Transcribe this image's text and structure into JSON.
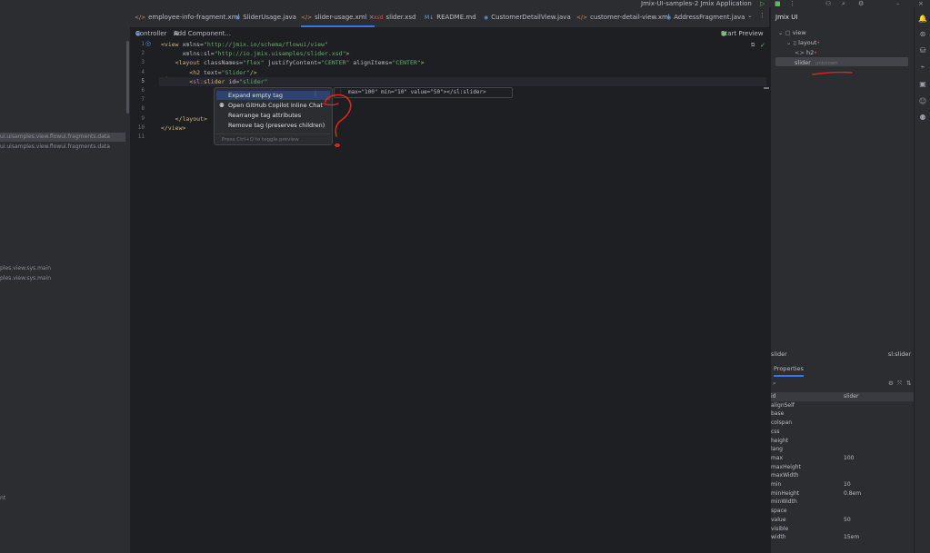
{
  "titlebar": {
    "run_config": "Jmix-UI-samples-2 Jmix Application",
    "icons": [
      "run-icon",
      "debug-icon",
      "more-icon",
      "add-user-icon",
      "search-icon",
      "settings-icon",
      "minimize-icon",
      "close-icon"
    ]
  },
  "project_panel": {
    "rows": [
      {
        "label": "ui.uisamples.view.flowui.fragments.data",
        "selected": true
      },
      {
        "label": "ui.uisamples.view.flowui.fragments.data",
        "selected": false
      },
      {
        "label": "ples.view.sys.main",
        "selected": false
      },
      {
        "label": "ples.view.sys.main",
        "selected": false
      },
      {
        "label": "nt",
        "selected": false
      }
    ]
  },
  "tabs": [
    {
      "label": "employee-info-fragment.xml",
      "type": "xml",
      "active": false
    },
    {
      "label": "SliderUsage.java",
      "type": "java",
      "active": false
    },
    {
      "label": "slider-usage.xml",
      "type": "xml",
      "active": true
    },
    {
      "label": "slider.xsd",
      "type": "xsd",
      "active": false
    },
    {
      "label": "README.md",
      "type": "md",
      "active": false
    },
    {
      "label": "CustomerDetailView.java",
      "type": "java",
      "active": false
    },
    {
      "label": "customer-detail-view.xml",
      "type": "xml",
      "active": false
    },
    {
      "label": "AddressFragment.java",
      "type": "java",
      "active": false
    }
  ],
  "editor_toolbar": {
    "controller": "Controller",
    "add_component": "Add Component...",
    "start_preview": "Start Preview"
  },
  "code": {
    "line_numbers": [
      "1",
      "2",
      "3",
      "4",
      "5",
      "6",
      "7",
      "8",
      "9",
      "10",
      "11"
    ],
    "current_line": 5,
    "lines": [
      [
        {
          "t": "<view ",
          "c": "tag"
        },
        {
          "t": "xmlns=",
          "c": "attr"
        },
        {
          "t": "\"http://jmix.io/schema/flowui/view\"",
          "c": "str"
        }
      ],
      [
        {
          "t": "      xmlns:sl=",
          "c": "attr"
        },
        {
          "t": "\"http://io.jmix.uisamples/slider.xsd\"",
          "c": "str"
        },
        {
          "t": ">",
          "c": "tag"
        }
      ],
      [
        {
          "t": "    <layout ",
          "c": "tag"
        },
        {
          "t": "classNames=",
          "c": "attr"
        },
        {
          "t": "\"flex\" ",
          "c": "str"
        },
        {
          "t": "justifyContent=",
          "c": "attr"
        },
        {
          "t": "\"CENTER\" ",
          "c": "str"
        },
        {
          "t": "alignItems=",
          "c": "attr"
        },
        {
          "t": "\"CENTER\"",
          "c": "str"
        },
        {
          "t": ">",
          "c": "tag"
        }
      ],
      [
        {
          "t": "        <h2 ",
          "c": "tag"
        },
        {
          "t": "text=",
          "c": "attr"
        },
        {
          "t": "\"Slider\"",
          "c": "str"
        },
        {
          "t": "/>",
          "c": "tag"
        }
      ],
      [
        {
          "t": "        <",
          "c": "tag"
        },
        {
          "t": "sl:",
          "c": "nsp"
        },
        {
          "t": "slider ",
          "c": "tag"
        },
        {
          "t": "id=",
          "c": "attr"
        },
        {
          "t": "\"slider\"",
          "c": "str"
        }
      ],
      [],
      [],
      [],
      [
        {
          "t": "    </layout>",
          "c": "tag"
        }
      ],
      [
        {
          "t": "</view>",
          "c": "tag"
        }
      ],
      []
    ]
  },
  "intent_menu": {
    "items": [
      {
        "label": "Expand empty tag",
        "highlighted": true,
        "icon": ""
      },
      {
        "label": "Open GitHub Copilot Inline Chat",
        "highlighted": false,
        "icon": "copilot-icon"
      },
      {
        "label": "Rearrange tag attributes",
        "highlighted": false,
        "icon": ""
      },
      {
        "label": "Remove tag (preserves children)",
        "highlighted": false,
        "icon": ""
      }
    ],
    "hint": "Press Ctrl+Q to toggle preview"
  },
  "preview": {
    "text": "max=\"100\" min=\"10\" value=\"50\"></sl:slider>"
  },
  "jmix_panel": {
    "title": "Jmix UI",
    "tree": [
      {
        "label": "view",
        "indent": 0
      },
      {
        "label": "layout",
        "indent": 1
      },
      {
        "label": "h2",
        "indent": 2
      },
      {
        "label": "slider",
        "indent": 2,
        "extra": "unknown"
      }
    ],
    "component_name": "slider",
    "component_type": "sl:slider",
    "properties_tab": "Properties",
    "properties": [
      {
        "name": "id",
        "value": "slider"
      },
      {
        "name": "alignSelf",
        "value": ""
      },
      {
        "name": "base",
        "value": ""
      },
      {
        "name": "colspan",
        "value": ""
      },
      {
        "name": "css",
        "value": ""
      },
      {
        "name": "height",
        "value": ""
      },
      {
        "name": "lang",
        "value": ""
      },
      {
        "name": "max",
        "value": "100"
      },
      {
        "name": "maxHeight",
        "value": ""
      },
      {
        "name": "maxWidth",
        "value": ""
      },
      {
        "name": "min",
        "value": "10"
      },
      {
        "name": "minHeight",
        "value": "0.8em"
      },
      {
        "name": "minWidth",
        "value": ""
      },
      {
        "name": "space",
        "value": ""
      },
      {
        "name": "value",
        "value": "50"
      },
      {
        "name": "visible",
        "value": ""
      },
      {
        "name": "width",
        "value": "15em"
      }
    ]
  },
  "colors": {
    "accent": "#3574f0",
    "annotation": "#e0241c",
    "string": "#6aab73",
    "tag": "#d5b778"
  }
}
